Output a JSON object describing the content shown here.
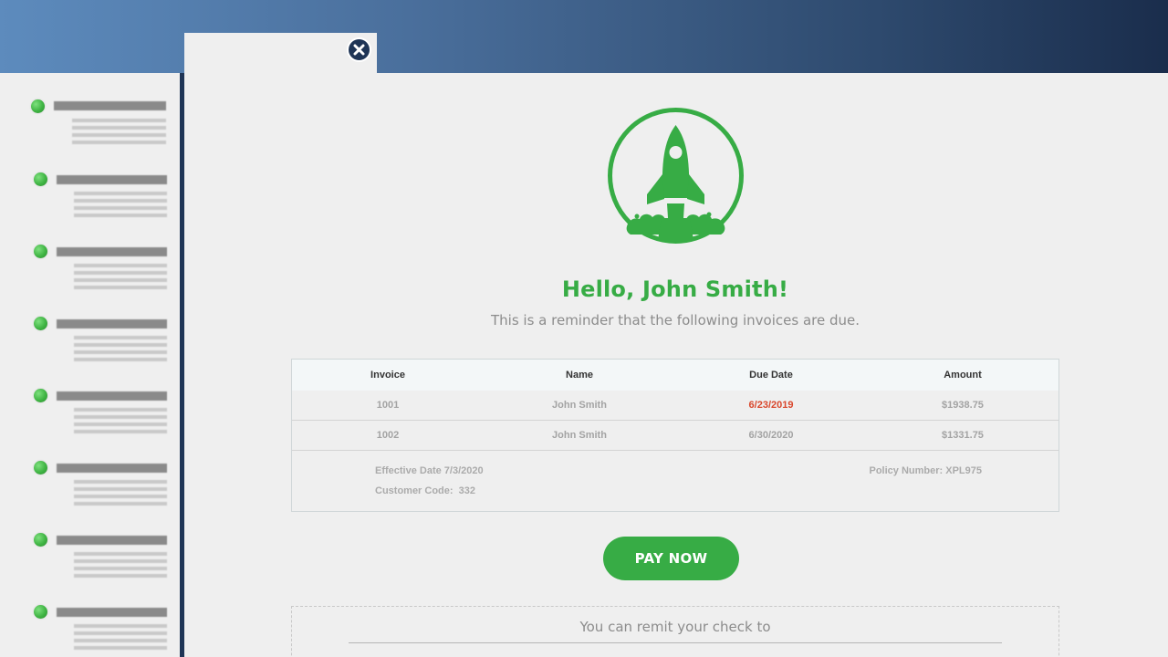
{
  "email": {
    "greeting": "Hello, John Smith!",
    "intro": "This is a reminder that the following invoices are due."
  },
  "invoices": {
    "headers": [
      "Invoice",
      "Name",
      "Due Date",
      "Amount"
    ],
    "rows": [
      {
        "invoice": "1001",
        "name": "John Smith",
        "due_date": "6/23/2019",
        "amount": "$1938.75",
        "overdue": true
      },
      {
        "invoice": "1002",
        "name": "John Smith",
        "due_date": "6/30/2020",
        "amount": "$1331.75",
        "overdue": false
      }
    ],
    "effective_date": "Effective Date 7/3/2020",
    "customer_code": "Customer Code:  332",
    "policy_number": "Policy Number: XPL975"
  },
  "actions": {
    "pay_label": "PAY NOW"
  },
  "remit": {
    "text": "You can remit your check to"
  },
  "sidebar": {
    "item_count": 8
  },
  "colors": {
    "accent_green": "#37ac45",
    "overdue_red": "#d9472c",
    "dark_navy": "#1f3556"
  },
  "icons": {
    "logo": "rocket-launch-icon",
    "tab_close": "close-icon",
    "list_status": "status-dot-icon"
  }
}
